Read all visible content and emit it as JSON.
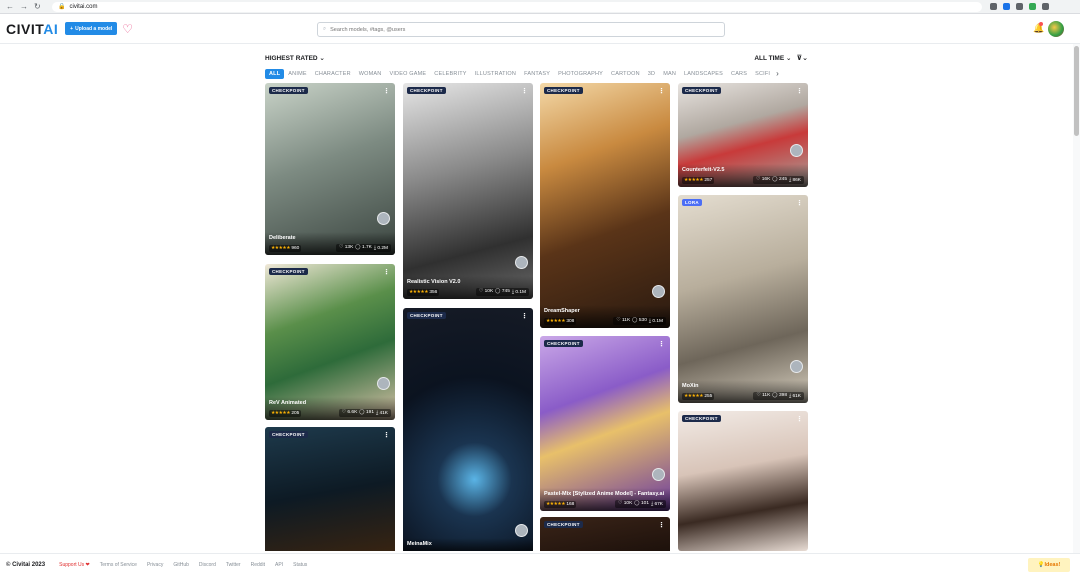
{
  "browser": {
    "url": "civitai.com"
  },
  "header": {
    "logo_main": "CIVIT",
    "logo_accent": "AI",
    "upload_label": "Upload a model",
    "search_placeholder": "Search models, #tags, @users"
  },
  "toolbar": {
    "sort_label": "HIGHEST RATED",
    "period_label": "ALL TIME"
  },
  "categories": [
    "ALL",
    "ANIME",
    "CHARACTER",
    "WOMAN",
    "VIDEO GAME",
    "CELEBRITY",
    "ILLUSTRATION",
    "FANTASY",
    "PHOTOGRAPHY",
    "CARTOON",
    "3D",
    "MAN",
    "LANDSCAPES",
    "CARS",
    "SCIFI"
  ],
  "active_category": "ALL",
  "cards": [
    {
      "badge": "CHECKPOINT",
      "title": "Deliberate",
      "rating": "960",
      "likes": "13K",
      "comments": "1.7K",
      "downloads": "0.2M",
      "bg": "linear-gradient(160deg,#c9d3c8,#7d8b82 45%,#3b4540)"
    },
    {
      "badge": "CHECKPOINT",
      "title": "ReV Animated",
      "rating": "205",
      "likes": "6.6K",
      "comments": "191",
      "downloads": "41K",
      "bg": "linear-gradient(160deg,#f0e8d8,#5a8f4a 35%,#2e6b3a 60%,#d9c2a8)"
    },
    {
      "badge": "CHECKPOINT",
      "title": "",
      "rating": "",
      "likes": "",
      "comments": "",
      "downloads": "",
      "bg": "linear-gradient(170deg,#1e3a4c,#0d1a24 50%,#3a2410)"
    },
    {
      "badge": "CHECKPOINT",
      "title": "Realistic Vision V2.0",
      "rating": "356",
      "likes": "10K",
      "comments": "745",
      "downloads": "0.1M",
      "bg": "linear-gradient(165deg,#e6e6e6,#8a8a8a 40%,#303030 75%,#6a6a6a)"
    },
    {
      "badge": "CHECKPOINT",
      "title": "MeinaMix",
      "rating": "",
      "likes": "",
      "comments": "",
      "downloads": "",
      "bg": "radial-gradient(circle at 55% 70%,#5ab4e6 0%,#1a3450 20%,#0b1320 55%,#161b26)"
    },
    {
      "badge": "CHECKPOINT",
      "title": "DreamShaper",
      "rating": "308",
      "likes": "11K",
      "comments": "530",
      "downloads": "0.1M",
      "bg": "linear-gradient(160deg,#f4d9a8,#c98a40 30%,#5a3418 60%,#2a1a10)"
    },
    {
      "badge": "CHECKPOINT",
      "title": "Pastel-Mix [Stylized Anime Model] - Fantasy.ai",
      "rating": "168",
      "likes": "10K",
      "comments": "101",
      "downloads": "67K",
      "bg": "linear-gradient(160deg,#caa8e8,#8a5cc8 35%,#e8c06a 55%,#6a3aa0)"
    },
    {
      "badge": "CHECKPOINT",
      "title": "",
      "rating": "",
      "likes": "",
      "comments": "",
      "downloads": "",
      "bg": "linear-gradient(170deg,#3a2418,#1a0f0a)"
    },
    {
      "badge": "CHECKPOINT",
      "title": "Counterfeit-V2.5",
      "rating": "257",
      "likes": "16K",
      "comments": "245",
      "downloads": "86K",
      "bg": "linear-gradient(165deg,#e8e4e0,#b0a8a0 40%,#c83a3a 60%,#a8a49e)"
    },
    {
      "badge": "LORA",
      "title": "MoXin",
      "rating": "255",
      "likes": "11K",
      "comments": "398",
      "downloads": "61K",
      "bg": "linear-gradient(165deg,#e4ddd0,#b8ae9c 40%,#6e665a 70%,#d8d0c0)"
    },
    {
      "badge": "CHECKPOINT",
      "title": "",
      "rating": "",
      "likes": "",
      "comments": "",
      "downloads": "",
      "bg": "linear-gradient(170deg,#f2ebe6,#d8c4b8 40%,#3a2a22 70%,#e8dcd4)"
    }
  ],
  "footer": {
    "copyright": "© Civitai 2023",
    "links": [
      "Support Us ❤",
      "Terms of Service",
      "Privacy",
      "GitHub",
      "Discord",
      "Twitter",
      "Reddit",
      "API",
      "Status"
    ],
    "ideas": "Ideas!"
  }
}
